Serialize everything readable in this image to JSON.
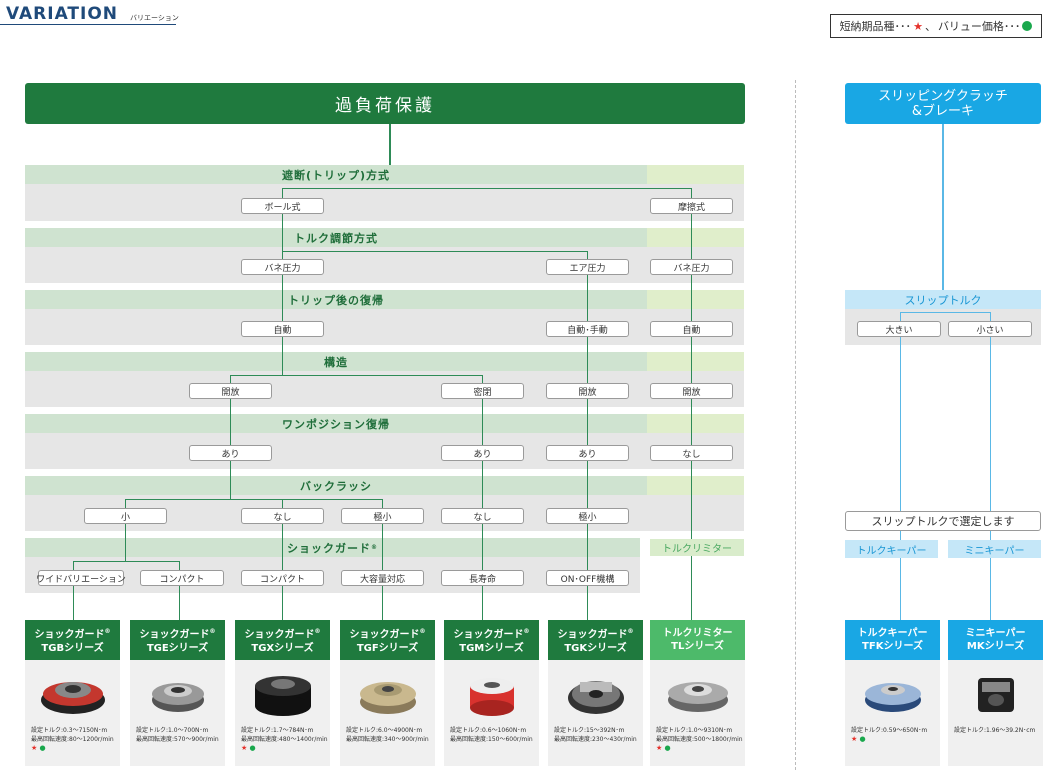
{
  "header": {
    "title": "VARIATION",
    "subtitle": "バリエーション"
  },
  "legend": {
    "short_label": "短納期品種･･･",
    "sep": "、",
    "value_label": "バリュー価格･･･"
  },
  "left_top": "過負荷保護",
  "right_top": {
    "line1": "スリッピングクラッチ",
    "line2": "&ブレーキ"
  },
  "bands": {
    "b1": "遮断(トリップ)方式",
    "b2": "トルク調節方式",
    "b3": "トリップ後の復帰",
    "b4": "構造",
    "b5": "ワンポジション復帰",
    "b6": "バックラッシ",
    "b7": "ショックガード",
    "slip": "スリップトルク"
  },
  "options": {
    "ball": "ボール式",
    "friction": "摩擦式",
    "spring1": "バネ圧力",
    "air": "エア圧力",
    "spring2": "バネ圧力",
    "auto1": "自動",
    "auto_manual": "自動･手動",
    "auto2": "自動",
    "open1": "開放",
    "closed": "密閉",
    "open2": "開放",
    "open3": "開放",
    "yes1": "あり",
    "yes2": "あり",
    "yes3": "あり",
    "none1": "なし",
    "small": "小",
    "none2": "なし",
    "tiny1": "極小",
    "none3": "なし",
    "tiny2": "極小",
    "wide": "ワイドバリエーション",
    "compact1": "コンパクト",
    "compact2": "コンパクト",
    "large": "大容量対応",
    "long": "長寿命",
    "onoff": "ON･OFF機構",
    "big": "大きい",
    "little": "小さい"
  },
  "torque_limiter_label": "トルクリミター",
  "slip_note": "スリップトルクで選定します",
  "blue_tags": {
    "keeper": "トルクキーパー",
    "mini": "ミニキーパー"
  },
  "reg": "®",
  "cards": [
    {
      "name": "ショックガード",
      "series": "TGBシリーズ",
      "spec1": "設定トルク:0.3〜7150N･m",
      "spec2": "最高回転速度:80〜1200r/min",
      "star": "★",
      "dot": "●"
    },
    {
      "name": "ショックガード",
      "series": "TGEシリーズ",
      "spec1": "設定トルク:1.0〜700N･m",
      "spec2": "最高回転速度:570〜900r/min"
    },
    {
      "name": "ショックガード",
      "series": "TGXシリーズ",
      "spec1": "設定トルク:1.7〜784N･m",
      "spec2": "最高回転速度:480〜1400r/min",
      "star": "★",
      "dot": "●"
    },
    {
      "name": "ショックガード",
      "series": "TGFシリーズ",
      "spec1": "設定トルク:6.0〜4900N･m",
      "spec2": "最高回転速度:340〜900r/min"
    },
    {
      "name": "ショックガード",
      "series": "TGMシリーズ",
      "spec1": "設定トルク:0.6〜1060N･m",
      "spec2": "最高回転速度:150〜600r/min"
    },
    {
      "name": "ショックガード",
      "series": "TGKシリーズ",
      "spec1": "設定トルク:15〜392N･m",
      "spec2": "最高回転速度:230〜430r/min"
    },
    {
      "name": "トルクリミター",
      "series": "TLシリーズ",
      "spec1": "設定トルク:1.0〜9310N･m",
      "spec2": "最高回転速度:500〜1800r/min",
      "star": "★",
      "dot": "●"
    },
    {
      "name": "トルクキーパー",
      "series": "TFKシリーズ",
      "spec1": "設定トルク:0.59〜650N･m",
      "spec2": "",
      "star": "★",
      "dot": "●"
    },
    {
      "name": "ミニキーパー",
      "series": "MKシリーズ",
      "spec1": "設定トルク:1.96〜39.2N･cm",
      "spec2": ""
    }
  ],
  "colors": {
    "dark_green": "#1f7a3e",
    "light_green": "#4dba6a",
    "blue": "#19a7e4"
  }
}
